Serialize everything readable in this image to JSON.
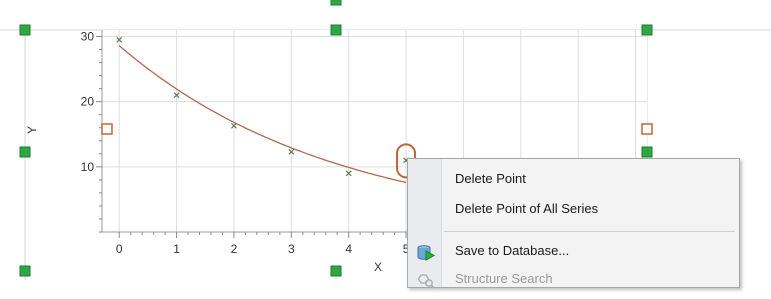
{
  "chart_data": {
    "type": "scatter",
    "title": "",
    "xlabel": "X",
    "ylabel": "Y",
    "xlim": [
      -0.3,
      9.2
    ],
    "ylim": [
      0,
      31
    ],
    "x_ticks": [
      0,
      1,
      2,
      3,
      4,
      5
    ],
    "y_ticks": [
      10,
      20,
      30
    ],
    "grid": true,
    "series": [
      {
        "marker": "x",
        "color": "#5c7a5c",
        "x": [
          0,
          1,
          2,
          3,
          4,
          5
        ],
        "y": [
          29.5,
          21,
          16.3,
          12.3,
          9,
          11
        ]
      }
    ],
    "fit_curve": {
      "color": "#b3674d",
      "x": [
        0,
        1,
        2,
        3,
        4,
        5
      ],
      "y": [
        28.6,
        22.2,
        17.2,
        13.2,
        10.1,
        7.6
      ]
    },
    "selected_point": {
      "x": 5,
      "y": 11,
      "highlight_color": "#c0653b"
    }
  },
  "context_menu": {
    "items": [
      {
        "label": "Delete Point",
        "enabled": true,
        "icon": ""
      },
      {
        "label": "Delete Point of All Series",
        "enabled": true,
        "icon": ""
      },
      {
        "label": "Save to Database...",
        "enabled": true,
        "icon": "database-save-icon"
      },
      {
        "label": "Structure Search",
        "enabled": false,
        "icon": "structure-search-icon"
      }
    ]
  },
  "colors": {
    "handle_green": "#2da843",
    "handle_orange": "#c0653b",
    "grid": "#dcdcdc",
    "menu_bg": "#f3f3f3"
  }
}
